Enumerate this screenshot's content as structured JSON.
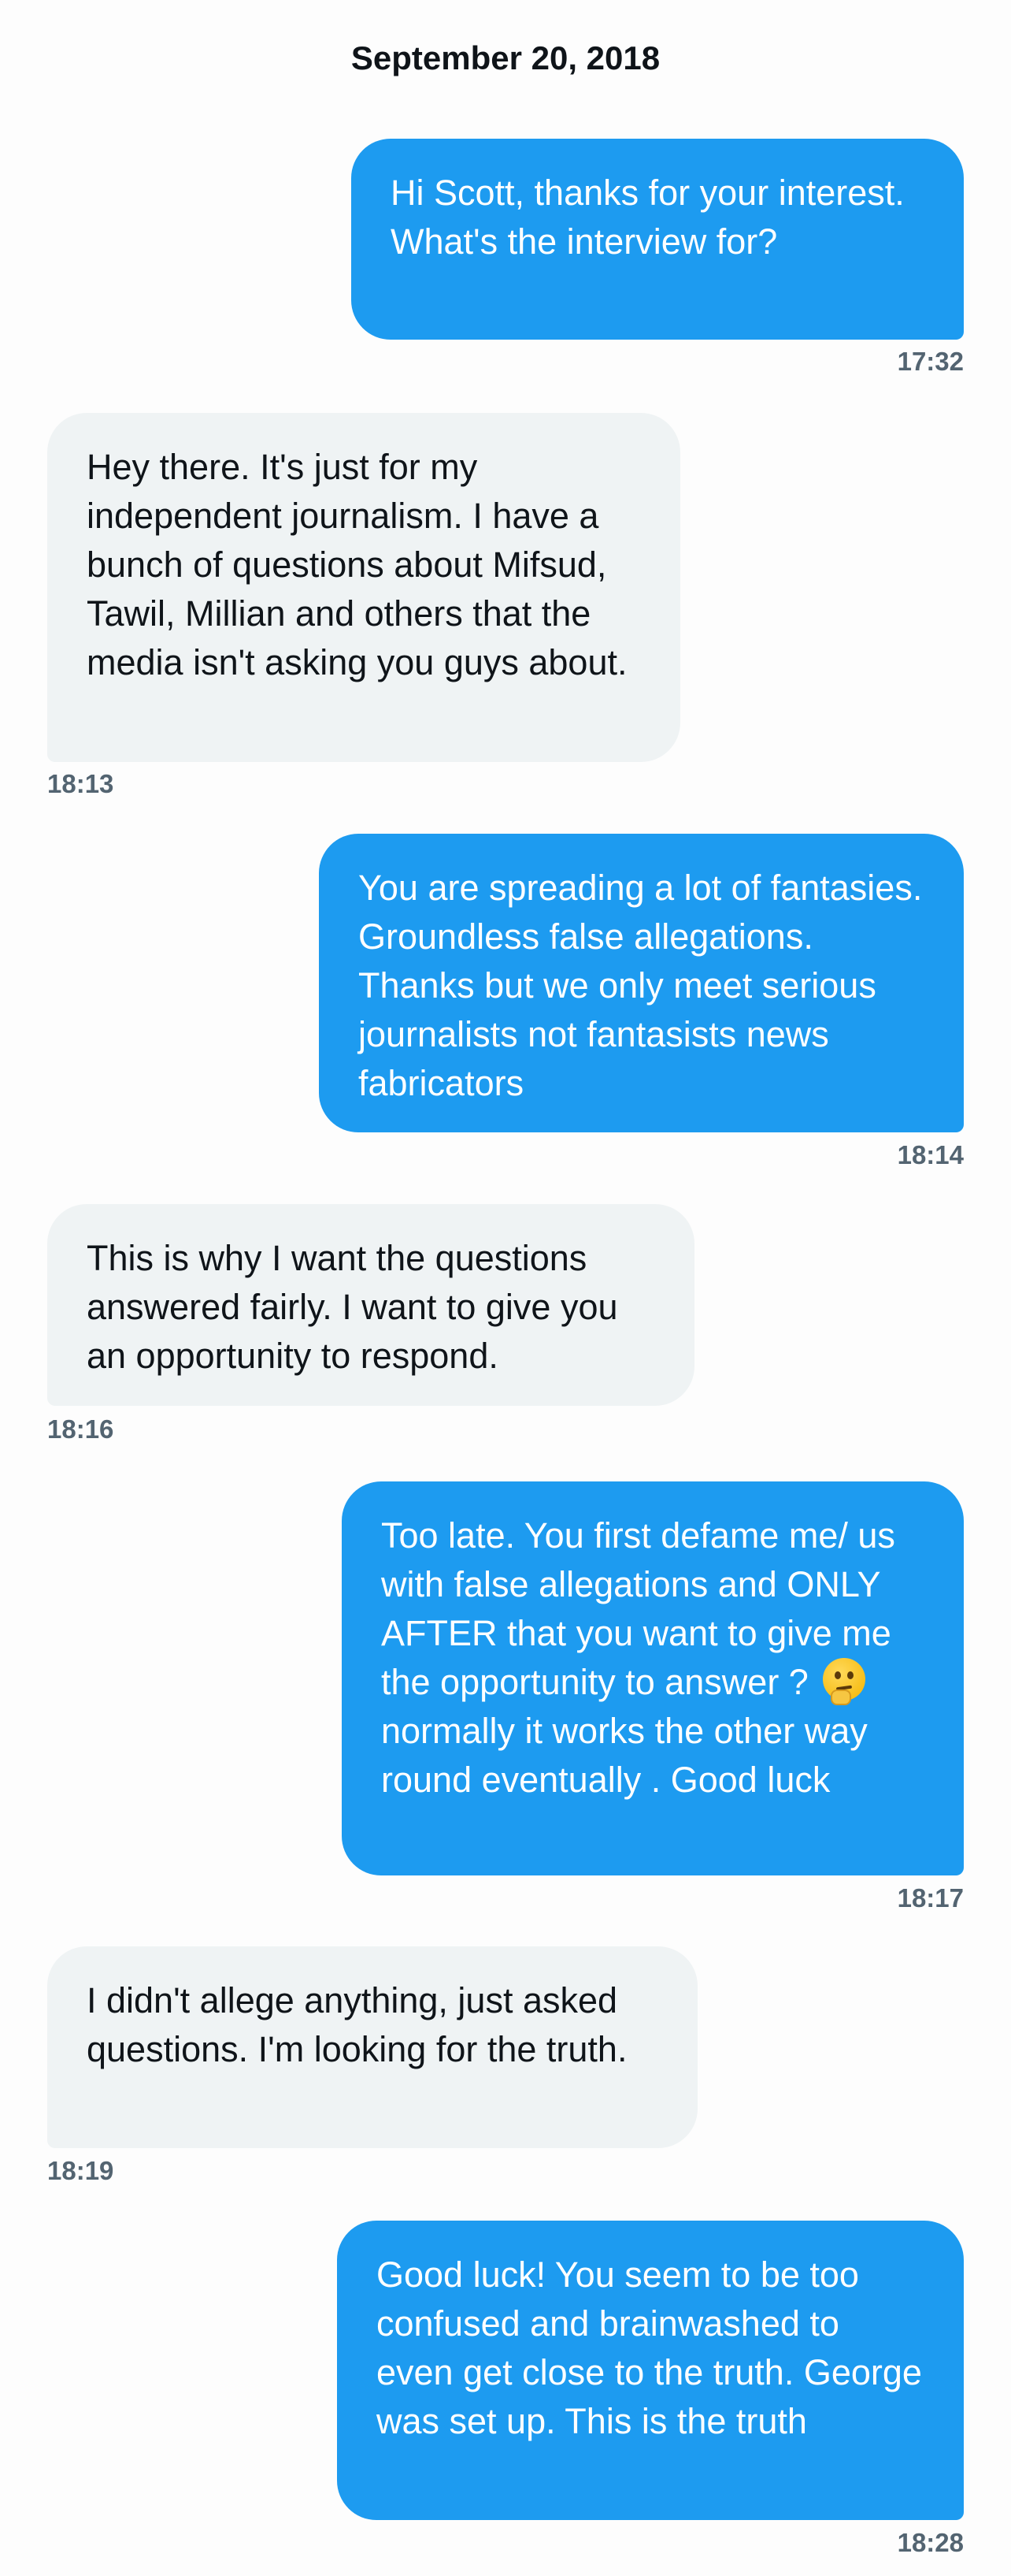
{
  "conversation": {
    "date": "September 20, 2018",
    "messages": [
      {
        "side": "sent",
        "text": "Hi Scott, thanks for your interest. What's the interview for?",
        "time": "17:32"
      },
      {
        "side": "received",
        "text": "Hey there. It's just for my independent journalism. I have a bunch of questions about Mifsud, Tawil, Millian and others that the media isn't asking you guys about.",
        "time": "18:13"
      },
      {
        "side": "sent",
        "text": "You are spreading a lot of fantasies. Groundless false allegations. Thanks but we only meet serious journalists not fantasists news fabricators",
        "time": "18:14"
      },
      {
        "side": "received",
        "text": "This is why I want the questions answered fairly. I want to give you an opportunity to respond.",
        "time": "18:16"
      },
      {
        "side": "sent",
        "text_before_emoji": "Too late. You first defame me/ us with false allegations and ONLY AFTER that you want to give me the opportunity to answer ?",
        "emoji": "thinking-face-emoji",
        "text_after_emoji": "normally it works the other way round eventually . Good luck",
        "time": "18:17"
      },
      {
        "side": "received",
        "text": "I didn't allege anything, just asked questions. I'm looking for the truth.",
        "time": "18:19"
      },
      {
        "side": "sent",
        "text": "Good luck! You seem to be too confused and brainwashed to even get close to the truth. George was set up. This is the truth",
        "time": "18:28"
      }
    ]
  },
  "colors": {
    "sent_bubble": "#1d9bf0",
    "received_bubble": "#eff3f4",
    "timestamp": "#536471"
  }
}
